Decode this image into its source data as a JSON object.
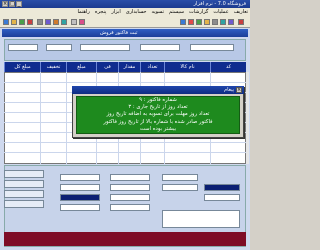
{
  "window": {
    "title": "فروشگاه 7.0 - نرم افزار"
  },
  "menu": {
    "items": [
      "تعاریف",
      "عملیات",
      "گزارشات",
      "سیستم",
      "تسویه",
      "حسابداری",
      "ابزار",
      "پنجره",
      "راهنما"
    ]
  },
  "form": {
    "title": "ثبت فاکتور فروش",
    "grid_headers": [
      "کد",
      "نام کالا",
      "تعداد",
      "مقدار",
      "فی",
      "مبلغ",
      "تخفیف",
      "مبلغ کل"
    ]
  },
  "dialog": {
    "title": "پیغام",
    "close_label": "×",
    "lines": [
      "شماره فاکتور : ۹",
      "تعداد روز از تاریخ جاری : ۳",
      "تعداد روز مهلت برای تسویه به اضافه تاریخ روز",
      "فاکتور صادر شده با شماره بالا از تاریخ روز فاکتور",
      "بیشتر بوده است"
    ]
  },
  "colors": {
    "accent": "#0f2c8f",
    "dialog_bg": "#1e8a1e",
    "footer_strip": "#7e0c27"
  }
}
